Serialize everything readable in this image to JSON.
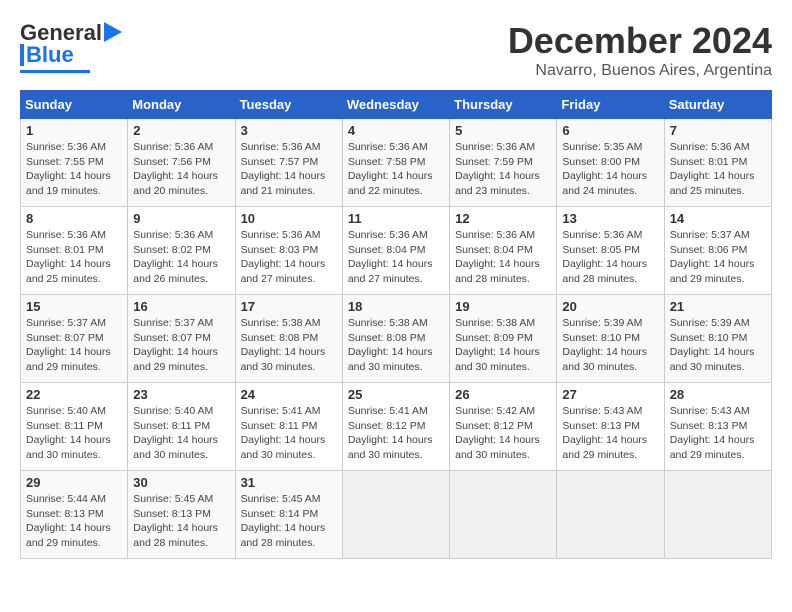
{
  "logo": {
    "text1": "General",
    "text2": "Blue"
  },
  "title": "December 2024",
  "subtitle": "Navarro, Buenos Aires, Argentina",
  "days_of_week": [
    "Sunday",
    "Monday",
    "Tuesday",
    "Wednesday",
    "Thursday",
    "Friday",
    "Saturday"
  ],
  "weeks": [
    [
      {
        "day": "1",
        "info": "Sunrise: 5:36 AM\nSunset: 7:55 PM\nDaylight: 14 hours\nand 19 minutes."
      },
      {
        "day": "2",
        "info": "Sunrise: 5:36 AM\nSunset: 7:56 PM\nDaylight: 14 hours\nand 20 minutes."
      },
      {
        "day": "3",
        "info": "Sunrise: 5:36 AM\nSunset: 7:57 PM\nDaylight: 14 hours\nand 21 minutes."
      },
      {
        "day": "4",
        "info": "Sunrise: 5:36 AM\nSunset: 7:58 PM\nDaylight: 14 hours\nand 22 minutes."
      },
      {
        "day": "5",
        "info": "Sunrise: 5:36 AM\nSunset: 7:59 PM\nDaylight: 14 hours\nand 23 minutes."
      },
      {
        "day": "6",
        "info": "Sunrise: 5:35 AM\nSunset: 8:00 PM\nDaylight: 14 hours\nand 24 minutes."
      },
      {
        "day": "7",
        "info": "Sunrise: 5:36 AM\nSunset: 8:01 PM\nDaylight: 14 hours\nand 25 minutes."
      }
    ],
    [
      {
        "day": "8",
        "info": "Sunrise: 5:36 AM\nSunset: 8:01 PM\nDaylight: 14 hours\nand 25 minutes."
      },
      {
        "day": "9",
        "info": "Sunrise: 5:36 AM\nSunset: 8:02 PM\nDaylight: 14 hours\nand 26 minutes."
      },
      {
        "day": "10",
        "info": "Sunrise: 5:36 AM\nSunset: 8:03 PM\nDaylight: 14 hours\nand 27 minutes."
      },
      {
        "day": "11",
        "info": "Sunrise: 5:36 AM\nSunset: 8:04 PM\nDaylight: 14 hours\nand 27 minutes."
      },
      {
        "day": "12",
        "info": "Sunrise: 5:36 AM\nSunset: 8:04 PM\nDaylight: 14 hours\nand 28 minutes."
      },
      {
        "day": "13",
        "info": "Sunrise: 5:36 AM\nSunset: 8:05 PM\nDaylight: 14 hours\nand 28 minutes."
      },
      {
        "day": "14",
        "info": "Sunrise: 5:37 AM\nSunset: 8:06 PM\nDaylight: 14 hours\nand 29 minutes."
      }
    ],
    [
      {
        "day": "15",
        "info": "Sunrise: 5:37 AM\nSunset: 8:07 PM\nDaylight: 14 hours\nand 29 minutes."
      },
      {
        "day": "16",
        "info": "Sunrise: 5:37 AM\nSunset: 8:07 PM\nDaylight: 14 hours\nand 29 minutes."
      },
      {
        "day": "17",
        "info": "Sunrise: 5:38 AM\nSunset: 8:08 PM\nDaylight: 14 hours\nand 30 minutes."
      },
      {
        "day": "18",
        "info": "Sunrise: 5:38 AM\nSunset: 8:08 PM\nDaylight: 14 hours\nand 30 minutes."
      },
      {
        "day": "19",
        "info": "Sunrise: 5:38 AM\nSunset: 8:09 PM\nDaylight: 14 hours\nand 30 minutes."
      },
      {
        "day": "20",
        "info": "Sunrise: 5:39 AM\nSunset: 8:10 PM\nDaylight: 14 hours\nand 30 minutes."
      },
      {
        "day": "21",
        "info": "Sunrise: 5:39 AM\nSunset: 8:10 PM\nDaylight: 14 hours\nand 30 minutes."
      }
    ],
    [
      {
        "day": "22",
        "info": "Sunrise: 5:40 AM\nSunset: 8:11 PM\nDaylight: 14 hours\nand 30 minutes."
      },
      {
        "day": "23",
        "info": "Sunrise: 5:40 AM\nSunset: 8:11 PM\nDaylight: 14 hours\nand 30 minutes."
      },
      {
        "day": "24",
        "info": "Sunrise: 5:41 AM\nSunset: 8:11 PM\nDaylight: 14 hours\nand 30 minutes."
      },
      {
        "day": "25",
        "info": "Sunrise: 5:41 AM\nSunset: 8:12 PM\nDaylight: 14 hours\nand 30 minutes."
      },
      {
        "day": "26",
        "info": "Sunrise: 5:42 AM\nSunset: 8:12 PM\nDaylight: 14 hours\nand 30 minutes."
      },
      {
        "day": "27",
        "info": "Sunrise: 5:43 AM\nSunset: 8:13 PM\nDaylight: 14 hours\nand 29 minutes."
      },
      {
        "day": "28",
        "info": "Sunrise: 5:43 AM\nSunset: 8:13 PM\nDaylight: 14 hours\nand 29 minutes."
      }
    ],
    [
      {
        "day": "29",
        "info": "Sunrise: 5:44 AM\nSunset: 8:13 PM\nDaylight: 14 hours\nand 29 minutes."
      },
      {
        "day": "30",
        "info": "Sunrise: 5:45 AM\nSunset: 8:13 PM\nDaylight: 14 hours\nand 28 minutes."
      },
      {
        "day": "31",
        "info": "Sunrise: 5:45 AM\nSunset: 8:14 PM\nDaylight: 14 hours\nand 28 minutes."
      },
      {
        "day": "",
        "info": ""
      },
      {
        "day": "",
        "info": ""
      },
      {
        "day": "",
        "info": ""
      },
      {
        "day": "",
        "info": ""
      }
    ]
  ]
}
